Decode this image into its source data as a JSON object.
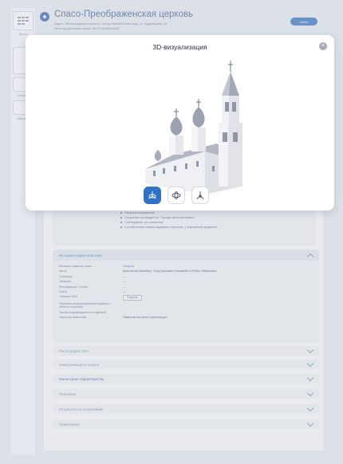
{
  "rail": {
    "items": [
      {
        "label": "Всего"
      },
      {
        "label": ""
      },
      {
        "label": ""
      },
      {
        "label": "Объект"
      },
      {
        "label": "Объекты"
      }
    ]
  },
  "header": {
    "title": "Спасо-Преображенская церковь",
    "address": "Адрес: Ленинградская область, город Нижний Новгород, ул. Кудрявцева, 24",
    "reg_number": "Регистрационный номер: 307474000690645",
    "action_button": "Action"
  },
  "modal": {
    "title": "3D-визуализация",
    "close_label": "×",
    "tools": [
      {
        "icon": "rotate-axes-icon",
        "active": true
      },
      {
        "icon": "orbit-view-icon",
        "active": false
      },
      {
        "icon": "pan-axes-icon",
        "active": false
      }
    ]
  },
  "features": {
    "items": [
      "Раскрытие/развитие",
      "Сохранно-исследуется. Тороды восстановлено",
      "Соблюдение регламентов",
      "Соответствие плана-задания и проекта, с изучаемой моделью"
    ]
  },
  "characteristics": {
    "title": "Историко-характеристики",
    "rows": [
      {
        "key": "История создания слово",
        "value": "Открыть",
        "link": true
      },
      {
        "key": "Автор",
        "value": "Архитектор Мюнзберг. Лорд Карлович Гольцвейн и Роберт Мейерович",
        "link": false
      },
      {
        "key": "Страница",
        "value": "—",
        "link": false
      },
      {
        "key": "Заказчик",
        "value": "—",
        "link": false
      },
      {
        "key": "Реставрация / Строит.",
        "value": "—",
        "link": false
      },
      {
        "key": "Стиль",
        "value": "—",
        "link": false
      },
      {
        "key": "Элемент ОКН",
        "value": "Открыть",
        "link": false,
        "button": true
      },
      {
        "key": "Перечень информационной надписи и объекта-носителя",
        "value": "",
        "link": false
      },
      {
        "key": "Тексты информационных надписей",
        "value": "",
        "link": false
      },
      {
        "key": "Характер памятника",
        "value": "Памятник истории и архитектуры",
        "link": false
      }
    ]
  },
  "accordions": [
    {
      "label": "Регистрация ОКН",
      "strong": false
    },
    {
      "label": "Коммуникация в охране",
      "strong": false
    },
    {
      "label": "Мониторинг характеристик",
      "strong": true
    },
    {
      "label": "Правовые",
      "strong": false
    },
    {
      "label": "Результаты исследований",
      "strong": false
    },
    {
      "label": "Примечания",
      "strong": false
    }
  ]
}
